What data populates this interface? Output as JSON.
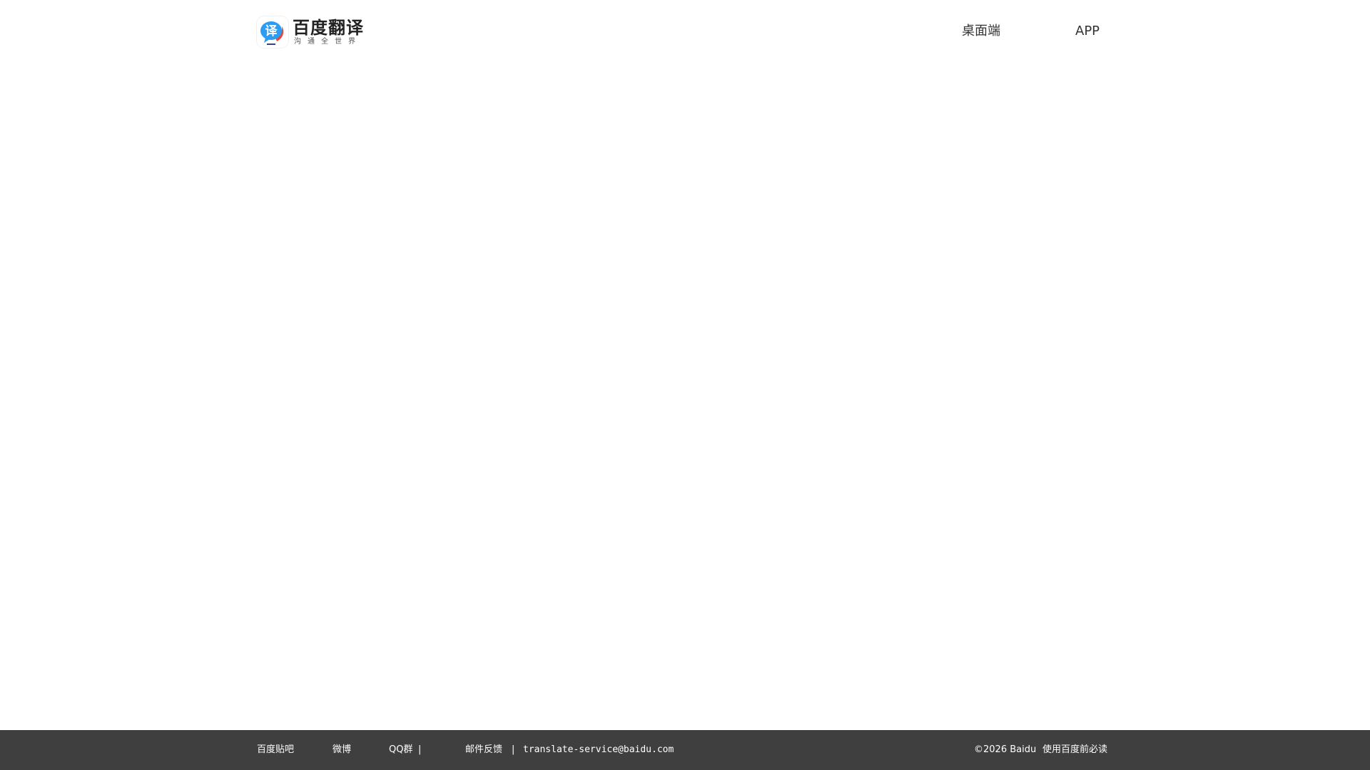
{
  "header": {
    "logo": {
      "icon": "translate-bubble-icon",
      "icon_glyph": "译",
      "title": "百度翻译",
      "subtitle": "沟通全世界"
    },
    "nav": {
      "desktop": "桌面端",
      "app": "APP"
    }
  },
  "footer": {
    "tieba": "百度贴吧",
    "weibo": "微博",
    "qq": "QQ群",
    "separator": "|",
    "mail_label": "邮件反馈",
    "email": "translate-service@baidu.com",
    "copyright": "©2026 Baidu",
    "terms": "使用百度前必读"
  },
  "colors": {
    "footer_bg": "#3f3f3f",
    "logo_blue": "#2e9cf0",
    "logo_red": "#e8453c"
  }
}
